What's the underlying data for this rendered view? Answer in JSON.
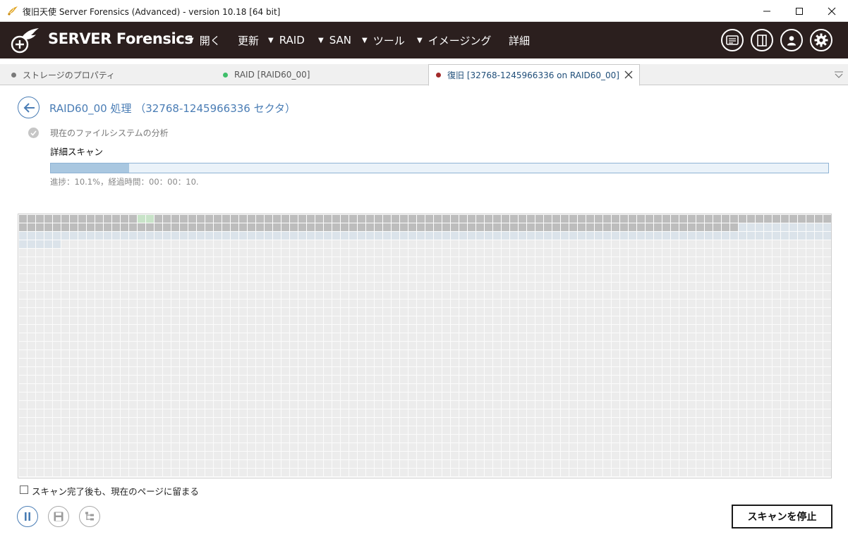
{
  "window": {
    "title": "復旧天使 Server Forensics (Advanced) - version 10.18 [64 bit]",
    "icons": [
      "app-logo-icon",
      "minimize-icon",
      "maximize-icon",
      "close-icon"
    ]
  },
  "header": {
    "brand": "SERVER Forensics",
    "menu": [
      {
        "label": "開く",
        "has_caret": true
      },
      {
        "label": "更新",
        "has_caret": false
      },
      {
        "label": "RAID",
        "has_caret": true
      },
      {
        "label": "SAN",
        "has_caret": true
      },
      {
        "label": "ツール",
        "has_caret": true
      },
      {
        "label": "イメージング",
        "has_caret": true
      },
      {
        "label": "詳細",
        "has_caret": false
      }
    ],
    "caret": "▼",
    "right_icons": [
      "messages-icon",
      "panel-icon",
      "user-icon",
      "settings-icon"
    ],
    "background_color": "#2b1f1e"
  },
  "tabs": [
    {
      "label": "ストレージのプロパティ",
      "dot_color": "#7a7a7a",
      "active": false
    },
    {
      "label": "RAID [RAID60_00]",
      "dot_color": "#3fbf6a",
      "active": false
    },
    {
      "label": "復旧 [32768-1245966336 on RAID60_00]",
      "dot_color": "#a32b2b",
      "active": true
    }
  ],
  "main": {
    "title": "RAID60_00 処理 （32768-1245966336 セクタ）",
    "step_done": "現在のファイルシステムの分析",
    "step_current": "詳細スキャン",
    "progress_percent": 10.1,
    "progress_text": "進捗：10.1%，経過時間：00：00：10.",
    "stay_on_page_label": "スキャン完了後も、現在のページに留まる",
    "stay_on_page_checked": false,
    "stop_button": "スキャンを停止",
    "bottom_icons": [
      "pause-icon",
      "save-icon",
      "tree-icon"
    ]
  },
  "sector_map": {
    "columns": 96,
    "rows": 31,
    "colors": {
      "scanned": "#bdbdbd",
      "found": "#c8e3c8",
      "pending": "#dbe3ea",
      "empty": "#ececec",
      "gap": "#fbfbfb"
    },
    "scanned_cells": 181,
    "found_cells": [
      14,
      15
    ],
    "pending_cells": 112
  }
}
